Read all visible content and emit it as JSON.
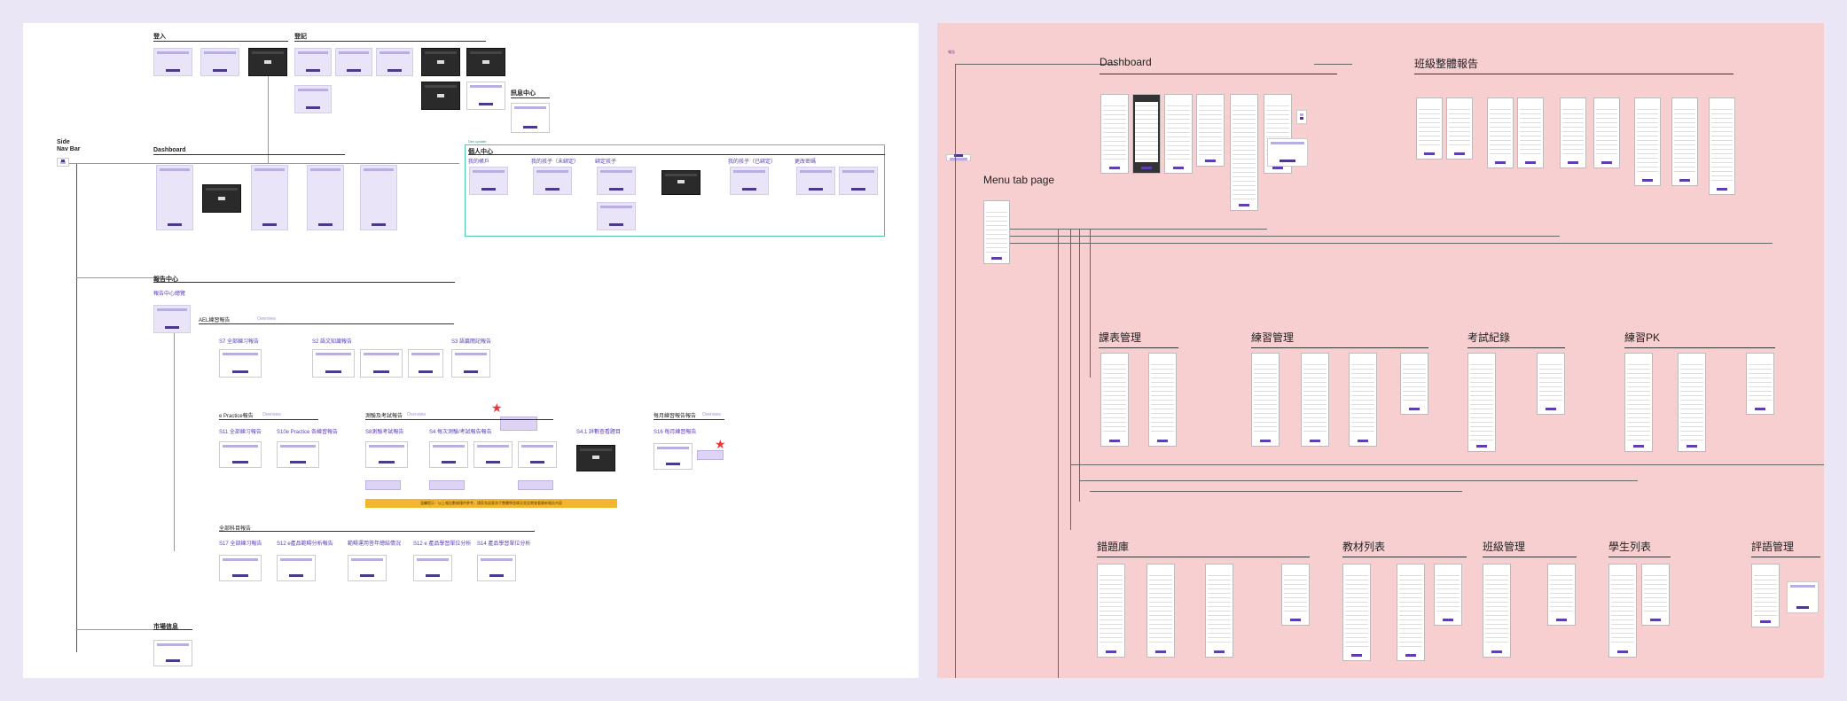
{
  "left_board": {
    "sections": {
      "login": "登入",
      "register": "登記",
      "message_center": "訊息中心",
      "side_nav_bar": "Side\nNav Bar",
      "dashboard": "Dashboard",
      "report_center": "報告中心",
      "report_center_overview": "報告中心總覽",
      "personal_center": "個人中心",
      "market_info": "市場信息"
    },
    "personal_center_items": [
      "我的帳戶",
      "我的孩子（未綁定）",
      "綁定孩子",
      "我的孩子（已綁定）",
      "更改密碼"
    ],
    "personal_center_note": "Dev update",
    "aei_report": "AEL練習報告",
    "aei_items": [
      "S7 全部練习報告",
      "S2 語文知識報告",
      "S3 語篇閱記報告"
    ],
    "practice_report": "e Practice報告",
    "practice_items": [
      "S11 全部練习報告",
      "S10e Practice 各練習報告"
    ],
    "exam_report": "測驗及考試報告",
    "exam_items": [
      "S8測驗考試報告",
      "S4 每次測驗/考試報告報告",
      "S4.1 詳數查看題目"
    ],
    "monthly_report": "每月練習報告報告",
    "monthly_items": [
      "S16 每月練習報告"
    ],
    "subject_report": "全部科目報告",
    "subject_items": [
      "S17 全部練习報告",
      "S12 e產品範疇分析報告",
      "範疇運用答年總結情況",
      "S12 e 產品學習單位分析",
      "S14 產品學習單位分析"
    ],
    "faint_label": "Overview",
    "banner_text": "溫馨提示：以上報告數據僅供參考，請家長留意孩子整體學習情況並定期查看最新報告內容"
  },
  "right_board": {
    "sections": {
      "dashboard": "Dashboard",
      "class_report": "班級整體報告",
      "menu_tab_page": "Menu tab page",
      "timetable": "課表管理",
      "practice": "練習管理",
      "exam_record": "考試紀錄",
      "practice_pk": "練習PK",
      "error_bank": "錯題庫",
      "material_list": "教材列表",
      "class_mgmt": "班級管理",
      "student_list": "學生列表",
      "comment_mgmt": "評語管理"
    },
    "top_tag": "報告"
  }
}
